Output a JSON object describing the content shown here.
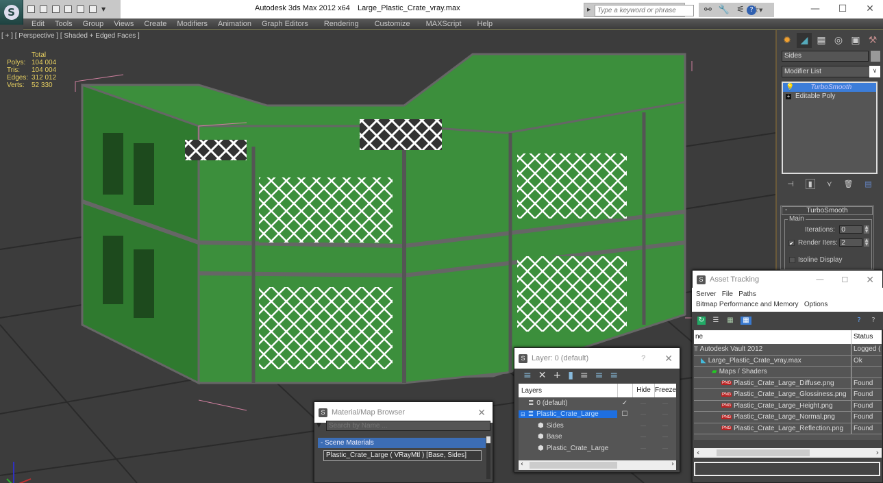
{
  "titlebar": {
    "app_title": "Autodesk 3ds Max  2012 x64",
    "file_name": "Large_Plastic_Crate_vray.max",
    "search_placeholder": "Type a keyword or phrase",
    "help_label": "?",
    "minimize": "—",
    "maximize": "☐",
    "close": "✕"
  },
  "quick_access": [
    "open-icon",
    "save-icon",
    "new-scene-icon",
    "project-icon",
    "undo-icon",
    "redo-icon",
    "customize-dropdown-icon"
  ],
  "menubar": [
    "Edit",
    "Tools",
    "Group",
    "Views",
    "Create",
    "Modifiers",
    "Animation",
    "Graph Editors",
    "Rendering",
    "Customize",
    "MAXScript",
    "Help"
  ],
  "viewport": {
    "label": "[ + ] [ Perspective ] [ Shaded + Edged Faces ]",
    "stats": {
      "header": "Total",
      "rows": [
        {
          "key": "Polys:",
          "value": "104 004"
        },
        {
          "key": "Tris:",
          "value": "104 004"
        },
        {
          "key": "Edges:",
          "value": "312 012"
        },
        {
          "key": "Verts:",
          "value": "52 330"
        }
      ]
    },
    "object_color": "#3c8f3c",
    "wire_color": "#ffffff"
  },
  "command_panel": {
    "tabs": [
      "create-tab",
      "modify-tab",
      "hierarchy-tab",
      "motion-tab",
      "display-tab",
      "utilities-tab"
    ],
    "object_name": "Sides",
    "modifier_list": "Modifier List",
    "stack": [
      {
        "label": "TurboSmooth",
        "selected": true
      },
      {
        "label": "Editable Poly",
        "selected": false
      }
    ],
    "rollout": {
      "title": "TurboSmooth",
      "group": "Main",
      "iterations_label": "Iterations:",
      "iterations_value": "0",
      "render_iters_label": "Render Iters:",
      "render_iters_value": "2",
      "render_iters_checked": true,
      "isoline_label": "Isoline Display",
      "isoline_checked": false
    }
  },
  "asset_tracking": {
    "title": "Asset Tracking",
    "menu_row1": [
      "Server",
      "File",
      "Paths"
    ],
    "menu_row2": [
      "Bitmap Performance and Memory",
      "Options"
    ],
    "columns": [
      "ne",
      "Status"
    ],
    "rows": [
      {
        "name": "Autodesk Vault 2012",
        "status": "Logged (",
        "indent": 0,
        "icon": "vault-icon"
      },
      {
        "name": "Large_Plastic_Crate_vray.max",
        "status": "Ok",
        "indent": 1,
        "icon": "max-file-icon"
      },
      {
        "name": "Maps / Shaders",
        "status": "",
        "indent": 2,
        "icon": "maps-icon"
      },
      {
        "name": "Plastic_Crate_Large_Diffuse.png",
        "status": "Found",
        "indent": 3,
        "icon": "png-icon"
      },
      {
        "name": "Plastic_Crate_Large_Glossiness.png",
        "status": "Found",
        "indent": 3,
        "icon": "png-icon"
      },
      {
        "name": "Plastic_Crate_Large_Height.png",
        "status": "Found",
        "indent": 3,
        "icon": "png-icon"
      },
      {
        "name": "Plastic_Crate_Large_Normal.png",
        "status": "Found",
        "indent": 3,
        "icon": "png-icon"
      },
      {
        "name": "Plastic_Crate_Large_Reflection.png",
        "status": "Found",
        "indent": 3,
        "icon": "png-icon"
      }
    ]
  },
  "layer_window": {
    "title": "Layer: 0 (default)",
    "help": "?",
    "columns": [
      "Layers",
      "Hide",
      "Freeze"
    ],
    "rows": [
      {
        "name": "0 (default)",
        "current": "✓",
        "selected": false,
        "indent": 1
      },
      {
        "name": "Plastic_Crate_Large",
        "current": "☐",
        "selected": true,
        "indent": 0
      },
      {
        "name": "Sides",
        "current": "",
        "selected": false,
        "indent": 2
      },
      {
        "name": "Base",
        "current": "",
        "selected": false,
        "indent": 2
      },
      {
        "name": "Plastic_Crate_Large",
        "current": "",
        "selected": false,
        "indent": 2
      }
    ],
    "dash": "—"
  },
  "material_browser": {
    "title": "Material/Map Browser",
    "search_placeholder": "Search by Name ...",
    "group": "- Scene Materials",
    "item": "Plastic_Crate_Large  ( VRayMtl ) [Base, Sides]"
  }
}
